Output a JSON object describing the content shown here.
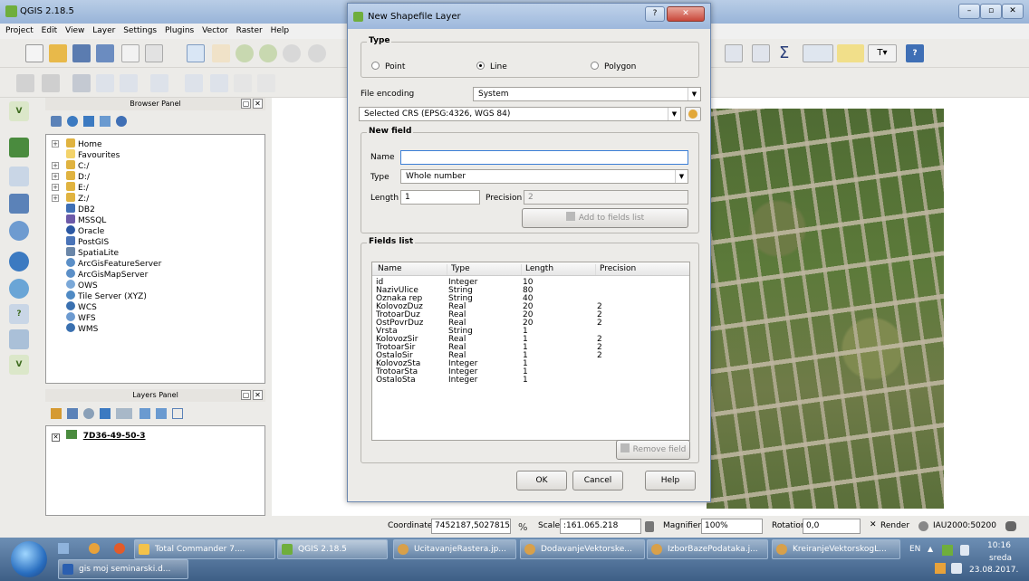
{
  "qgis": {
    "title": "QGIS 2.18.5",
    "menu": [
      "Project",
      "Edit",
      "View",
      "Layer",
      "Settings",
      "Plugins",
      "Vector",
      "Raster",
      "Help"
    ]
  },
  "browser_panel": {
    "title": "Browser Panel",
    "items": [
      {
        "label": "Home",
        "color": "#e0b340"
      },
      {
        "label": "Favourites",
        "color": "#f3d36b"
      },
      {
        "label": "C:/",
        "color": "#e0b340"
      },
      {
        "label": "D:/",
        "color": "#e0b340"
      },
      {
        "label": "E:/",
        "color": "#e0b340"
      },
      {
        "label": "Z:/",
        "color": "#e0b340"
      },
      {
        "label": "DB2",
        "color": "#3f6fb5"
      },
      {
        "label": "MSSQL",
        "color": "#6d5aa8"
      },
      {
        "label": "Oracle",
        "color": "#2b58a3"
      },
      {
        "label": "PostGIS",
        "color": "#4a74b8"
      },
      {
        "label": "SpatiaLite",
        "color": "#6a86a8"
      },
      {
        "label": "ArcGisFeatureServer",
        "color": "#5b8fc7"
      },
      {
        "label": "ArcGisMapServer",
        "color": "#5b8fc7"
      },
      {
        "label": "OWS",
        "color": "#7aa8d8"
      },
      {
        "label": "Tile Server (XYZ)",
        "color": "#4f8ac4"
      },
      {
        "label": "WCS",
        "color": "#3a70b0"
      },
      {
        "label": "WFS",
        "color": "#6c9ad0"
      },
      {
        "label": "WMS",
        "color": "#3a70b0"
      }
    ]
  },
  "layers_panel": {
    "title": "Layers Panel",
    "layer": "7D36-49-50-3"
  },
  "status_bar": {
    "coordinate_label": "Coordinate",
    "coordinate_value": "7452187,5027815",
    "scale_label": "Scale",
    "scale_value": ":161.065.218",
    "magnifier_label": "Magnifier",
    "magnifier_value": "100%",
    "rotation_label": "Rotation",
    "rotation_value": "0,0",
    "render_label": "Render",
    "crs": "IAU2000:50200"
  },
  "dialog": {
    "title": "New Shapefile Layer",
    "type_group": "Type",
    "types": [
      {
        "label": "Point",
        "selected": false
      },
      {
        "label": "Line",
        "selected": true
      },
      {
        "label": "Polygon",
        "selected": false
      }
    ],
    "file_encoding_label": "File encoding",
    "file_encoding_value": "System",
    "crs_value": "Selected CRS (EPSG:4326, WGS 84)",
    "new_field_group": "New field",
    "name_label": "Name",
    "name_value": "",
    "type_label": "Type",
    "type_value": "Whole number",
    "length_label": "Length",
    "length_value": "1",
    "precision_label": "Precision",
    "precision_value": "2",
    "add_button": "Add to fields list",
    "fields_list_group": "Fields list",
    "columns": [
      "Name",
      "Type",
      "Length",
      "Precision"
    ],
    "fields": [
      [
        "id",
        "Integer",
        "10",
        ""
      ],
      [
        "NazivUlice",
        "String",
        "80",
        ""
      ],
      [
        "Oznaka rep",
        "String",
        "40",
        ""
      ],
      [
        "KolovozDuz",
        "Real",
        "20",
        "2"
      ],
      [
        "TrotoarDuz",
        "Real",
        "20",
        "2"
      ],
      [
        "OstPovrDuz",
        "Real",
        "20",
        "2"
      ],
      [
        "Vrsta",
        "String",
        "1",
        ""
      ],
      [
        "KolovozSir",
        "Real",
        "1",
        "2"
      ],
      [
        "TrotoarSir",
        "Real",
        "1",
        "2"
      ],
      [
        "OstaloSir",
        "Real",
        "1",
        "2"
      ],
      [
        "KolovozSta",
        "Integer",
        "1",
        ""
      ],
      [
        "TrotoarSta",
        "Integer",
        "1",
        ""
      ],
      [
        "OstaloSta",
        "Integer",
        "1",
        ""
      ]
    ],
    "remove_button": "Remove field",
    "ok_button": "OK",
    "cancel_button": "Cancel",
    "help_button": "Help"
  },
  "taskbar": {
    "tasks": [
      "Total Commander 7....",
      "QGIS 2.18.5",
      "UcitavanjeRastera.jp...",
      "DodavanjeVektorske...",
      "IzborBazePodataka.j...",
      "KreiranjeVektorskogL..."
    ],
    "task2": "gis moj seminarski.d...",
    "lang": "EN",
    "time": "10:16",
    "day": "sreda",
    "date": "23.08.2017."
  }
}
